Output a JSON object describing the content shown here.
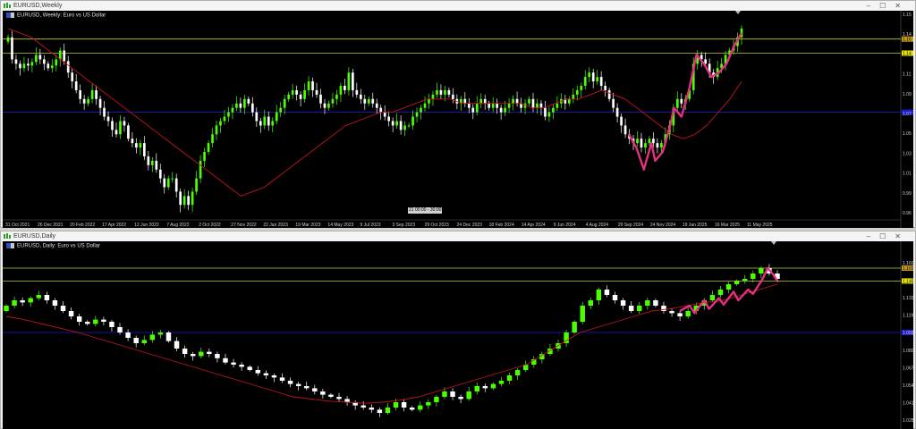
{
  "top_window": {
    "title": "EURUSD,Weekly",
    "symbol_label": "EURUSD, Weekly: Euro vs US Dollar",
    "date_marker": "21 00:00 - 30:00",
    "price_labels": [
      "1.15",
      "1.14",
      "1.13",
      "1.11",
      "1.09",
      "1.07",
      "1.05",
      "1.03",
      "1.01",
      "0.99",
      "0.96"
    ],
    "highlight_price_labels": [
      "1.16",
      "1.14"
    ],
    "time_labels": [
      "31 Oct 2021",
      "26 Dec 2021",
      "20 Feb 2022",
      "17 Apr 2022",
      "12 Jun 2022",
      "7 Aug 2022",
      "2 Oct 2022",
      "27 Nov 2022",
      "22 Jan 2023",
      "19 Mar 2023",
      "14 May 2023",
      "9 Jul 2023",
      "3 Sep 2023",
      "29 Oct 2023",
      "24 Dec 2023",
      "18 Feb 2024",
      "14 Apr 2024",
      "9 Jun 2024",
      "4 Aug 2024",
      "29 Sep 2024",
      "24 Nov 2024",
      "19 Jan 2025",
      "16 Mar 2025",
      "11 May 2025"
    ],
    "closes": [
      1.16,
      1.135,
      1.13,
      1.125,
      1.13,
      1.128,
      1.132,
      1.14,
      1.135,
      1.13,
      1.125,
      1.128,
      1.135,
      1.145,
      1.133,
      1.12,
      1.11,
      1.1,
      1.09,
      1.085,
      1.09,
      1.1,
      1.09,
      1.08,
      1.07,
      1.065,
      1.055,
      1.05,
      1.065,
      1.06,
      1.045,
      1.04,
      1.035,
      1.04,
      1.025,
      1.015,
      1.02,
      1.01,
      1.0,
      0.99,
      1.0,
      1.0,
      0.985,
      0.97,
      0.98,
      0.97,
      0.985,
      1.0,
      1.02,
      1.03,
      1.04,
      1.05,
      1.06,
      1.065,
      1.07,
      1.075,
      1.08,
      1.085,
      1.08,
      1.09,
      1.085,
      1.075,
      1.065,
      1.06,
      1.07,
      1.06,
      1.065,
      1.075,
      1.08,
      1.09,
      1.095,
      1.1,
      1.095,
      1.09,
      1.1,
      1.11,
      1.1,
      1.095,
      1.085,
      1.08,
      1.085,
      1.09,
      1.095,
      1.105,
      1.1,
      1.12,
      1.1,
      1.095,
      1.09,
      1.085,
      1.09,
      1.085,
      1.08,
      1.075,
      1.07,
      1.065,
      1.06,
      1.065,
      1.055,
      1.06,
      1.06,
      1.07,
      1.075,
      1.08,
      1.085,
      1.09,
      1.095,
      1.1,
      1.095,
      1.1,
      1.095,
      1.09,
      1.085,
      1.09,
      1.085,
      1.08,
      1.075,
      1.085,
      1.09,
      1.085,
      1.08,
      1.085,
      1.08,
      1.075,
      1.08,
      1.085,
      1.09,
      1.085,
      1.08,
      1.085,
      1.09,
      1.08,
      1.085,
      1.08,
      1.07,
      1.075,
      1.08,
      1.085,
      1.09,
      1.085,
      1.09,
      1.095,
      1.1,
      1.105,
      1.115,
      1.12,
      1.11,
      1.115,
      1.105,
      1.1,
      1.09,
      1.08,
      1.07,
      1.06,
      1.05,
      1.045,
      1.04,
      1.045,
      1.035,
      1.04,
      1.045,
      1.04,
      1.035,
      1.04,
      1.05,
      1.06,
      1.08,
      1.09,
      1.085,
      1.09,
      1.1,
      1.13,
      1.14,
      1.135,
      1.13,
      1.12,
      1.115,
      1.125,
      1.13,
      1.14,
      1.145,
      1.15,
      1.16,
      1.17
    ],
    "ma": [
      1.17,
      1.165,
      1.16,
      1.15,
      1.14,
      1.13,
      1.12,
      1.11,
      1.1,
      1.09,
      1.08,
      1.07,
      1.06,
      1.05,
      1.04,
      1.03,
      1.02,
      1.01,
      1.0,
      0.99,
      0.98,
      0.985,
      0.99,
      1.0,
      1.01,
      1.02,
      1.03,
      1.04,
      1.05,
      1.06,
      1.065,
      1.07,
      1.075,
      1.075,
      1.08,
      1.085,
      1.09,
      1.09,
      1.09,
      1.085,
      1.085,
      1.085,
      1.085,
      1.085,
      1.085,
      1.08,
      1.08,
      1.085,
      1.09,
      1.09,
      1.095,
      1.1,
      1.095,
      1.09,
      1.08,
      1.07,
      1.06,
      1.05,
      1.045,
      1.05,
      1.06,
      1.075,
      1.09,
      1.11
    ],
    "pink_path": [
      [
        0,
        1.05
      ],
      [
        2,
        1.035
      ],
      [
        4,
        1.01
      ],
      [
        6,
        1.04
      ],
      [
        7,
        1.02
      ],
      [
        9,
        1.03
      ],
      [
        11,
        1.06
      ],
      [
        12,
        1.08
      ],
      [
        14,
        1.07
      ],
      [
        16,
        1.1
      ],
      [
        18,
        1.14
      ],
      [
        20,
        1.13
      ],
      [
        22,
        1.115
      ],
      [
        24,
        1.12
      ],
      [
        26,
        1.13
      ],
      [
        28,
        1.15
      ],
      [
        30,
        1.165
      ]
    ]
  },
  "bottom_window": {
    "title": "EURUSD,Daily",
    "symbol_label": "EURUSD, Daily: Euro vs US Dollar",
    "price_labels": [
      "1.16020",
      "1.15510",
      "1.13300",
      "1.11990",
      "1.09370",
      "1.08060",
      "1.06750",
      "1.05440",
      "1.04130",
      "1.02820"
    ],
    "highlight_price_labels": [
      "1.16500",
      "1.14534"
    ],
    "closes": [
      1.125,
      1.13,
      1.128,
      1.132,
      1.135,
      1.13,
      1.125,
      1.12,
      1.115,
      1.11,
      1.108,
      1.112,
      1.11,
      1.105,
      1.1,
      1.095,
      1.09,
      1.093,
      1.098,
      1.1,
      1.092,
      1.085,
      1.08,
      1.078,
      1.082,
      1.08,
      1.076,
      1.072,
      1.07,
      1.068,
      1.065,
      1.062,
      1.06,
      1.058,
      1.055,
      1.052,
      1.05,
      1.048,
      1.045,
      1.042,
      1.04,
      1.038,
      1.035,
      1.032,
      1.03,
      1.028,
      1.025,
      1.03,
      1.035,
      1.03,
      1.028,
      1.032,
      1.035,
      1.04,
      1.045,
      1.04,
      1.038,
      1.045,
      1.05,
      1.048,
      1.052,
      1.055,
      1.06,
      1.065,
      1.07,
      1.075,
      1.08,
      1.085,
      1.09,
      1.1,
      1.11,
      1.125,
      1.13,
      1.14,
      1.135,
      1.13,
      1.125,
      1.12,
      1.125,
      1.13,
      1.125,
      1.12,
      1.118,
      1.115,
      1.12,
      1.125,
      1.13,
      1.135,
      1.14,
      1.145,
      1.148,
      1.15,
      1.155,
      1.16,
      1.155,
      1.15
    ],
    "ma": [
      1.115,
      1.112,
      1.108,
      1.104,
      1.1,
      1.095,
      1.09,
      1.085,
      1.08,
      1.075,
      1.07,
      1.065,
      1.06,
      1.055,
      1.05,
      1.045,
      1.04,
      1.038,
      1.036,
      1.035,
      1.034,
      1.035,
      1.037,
      1.04,
      1.045,
      1.05,
      1.055,
      1.06,
      1.065,
      1.07,
      1.08,
      1.09,
      1.1,
      1.105,
      1.11,
      1.115,
      1.12,
      1.122,
      1.125,
      1.128,
      1.13,
      1.135,
      1.14,
      1.145
    ],
    "pink_path": [
      [
        0,
        1.12
      ],
      [
        2,
        1.125
      ],
      [
        3,
        1.118
      ],
      [
        5,
        1.13
      ],
      [
        6,
        1.122
      ],
      [
        8,
        1.132
      ],
      [
        9,
        1.126
      ],
      [
        11,
        1.138
      ],
      [
        12,
        1.13
      ],
      [
        14,
        1.14
      ],
      [
        15,
        1.136
      ],
      [
        17,
        1.15
      ],
      [
        18,
        1.16
      ],
      [
        19,
        1.155
      ],
      [
        20,
        1.148
      ]
    ]
  },
  "colors": {
    "bull": "#4cff00",
    "bear": "#ffffff",
    "ma": "#c0151d",
    "pink": "#e6307f",
    "yellow_line": "#c8c832",
    "blue_line": "#1c1cd6",
    "axis_text": "#cfcfcf"
  }
}
